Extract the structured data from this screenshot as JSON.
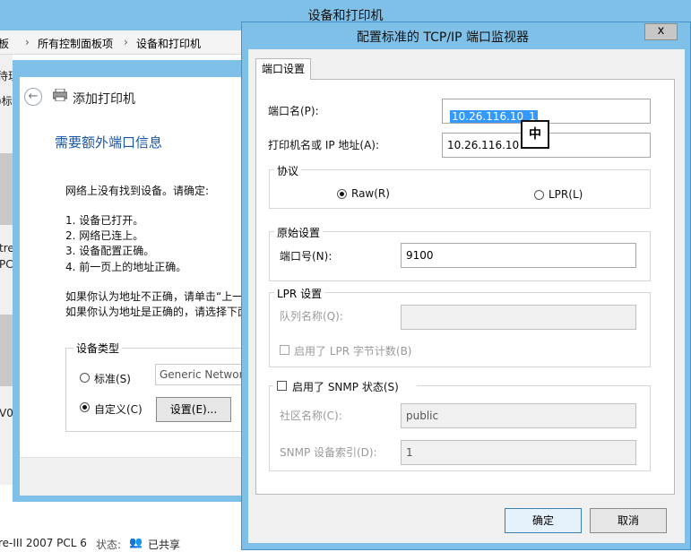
{
  "explorer": {
    "title": "设备和打印机",
    "breadcrumb": [
      "板",
      "所有控制面板项",
      "设备和打印机"
    ],
    "left_fragments": [
      "待现",
      ")标"
    ],
    "device_fragments": [
      "tre",
      "PCL",
      "V0'"
    ],
    "status": {
      "device": "re-III 2007 PCL 6",
      "state_label": "状态:",
      "share": "已共享"
    }
  },
  "wizard": {
    "title": "添加打印机",
    "heading": "需要额外端口信息",
    "intro": "网络上没有找到设备。请确定:",
    "checks": [
      "1.  设备已打开。",
      "2.  网络已连上。",
      "3.  设备配置正确。",
      "4.  前一页上的地址正确。"
    ],
    "note1": "如果你认为地址不正确，请单击“上一",
    "note2": "如果你认为地址是正确的，请选择下面",
    "device_type": {
      "legend": "设备类型",
      "standard_label": "标准(S)",
      "standard_value": "Generic Networ",
      "custom_label": "自定义(C)",
      "settings_button": "设置(E)...",
      "selected": "custom"
    }
  },
  "dialog": {
    "title": "配置标准的 TCP/IP 端口监视器",
    "close": "x",
    "tab": "端口设置",
    "port_name": {
      "label": "端口名(P):",
      "value": "10.26.116.10_1"
    },
    "printer_address": {
      "label": "打印机名或 IP 地址(A):",
      "value": "10.26.116.10"
    },
    "ime_indicator": "中",
    "protocol": {
      "legend": "协议",
      "raw": "Raw(R)",
      "lpr": "LPR(L)",
      "selected": "raw"
    },
    "raw_settings": {
      "legend": "原始设置",
      "port_number_label": "端口号(N):",
      "port_number": "9100"
    },
    "lpr_settings": {
      "legend": "LPR 设置",
      "queue_label": "队列名称(Q):",
      "queue_value": "",
      "byte_count_label": "启用了 LPR 字节计数(B)"
    },
    "snmp": {
      "legend": "启用了 SNMP 状态(S)",
      "community_label": "社区名称(C):",
      "community_value": "public",
      "index_label": "SNMP 设备索引(D):",
      "index_value": "1"
    },
    "ok": "确定",
    "cancel": "取消"
  }
}
